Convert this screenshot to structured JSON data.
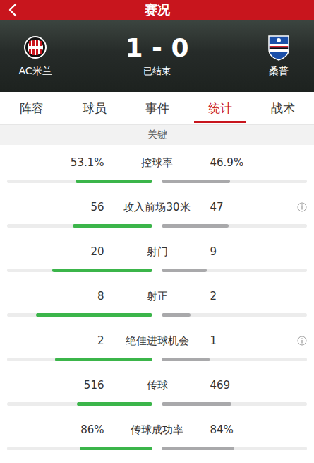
{
  "header": {
    "title": "赛况"
  },
  "match": {
    "home": "AC米兰",
    "away": "桑普",
    "score": "1 - 0",
    "status": "已结束"
  },
  "tabs": [
    {
      "label": "阵容",
      "selected": false
    },
    {
      "label": "球员",
      "selected": false
    },
    {
      "label": "事件",
      "selected": false
    },
    {
      "label": "统计",
      "selected": true
    },
    {
      "label": "战术",
      "selected": false
    }
  ],
  "section": "关键",
  "stats": [
    {
      "label": "控球率",
      "home": "53.1%",
      "away": "46.9%",
      "home_level": 0.53,
      "away_level": 0.47,
      "info": false
    },
    {
      "label": "攻入前场30米",
      "home": "56",
      "away": "47",
      "home_level": 0.55,
      "away_level": 0.46,
      "info": true
    },
    {
      "label": "射门",
      "home": "20",
      "away": "9",
      "home_level": 0.69,
      "away_level": 0.31,
      "info": false
    },
    {
      "label": "射正",
      "home": "8",
      "away": "2",
      "home_level": 0.8,
      "away_level": 0.2,
      "info": false
    },
    {
      "label": "绝佳进球机会",
      "home": "2",
      "away": "1",
      "home_level": 0.67,
      "away_level": 0.33,
      "info": true
    },
    {
      "label": "传球",
      "home": "516",
      "away": "469",
      "home_level": 0.52,
      "away_level": 0.48,
      "info": false
    },
    {
      "label": "传球成功率",
      "home": "86%",
      "away": "84%",
      "home_level": 0.5,
      "away_level": 0.5,
      "info": false
    }
  ]
}
